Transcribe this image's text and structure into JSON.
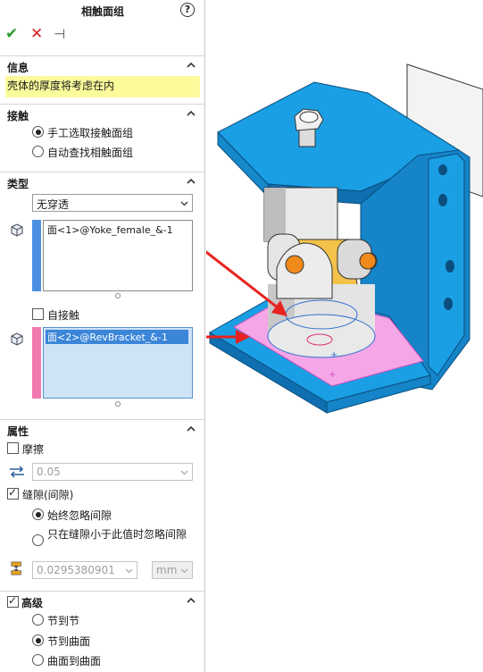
{
  "panel": {
    "title": "相触面组",
    "help_glyph": "?",
    "actions": {
      "ok": "✔",
      "cancel": "✕",
      "pin": "⊣"
    }
  },
  "info": {
    "header": "信息",
    "message": "壳体的厚度将考虑在内"
  },
  "contact": {
    "header": "接触",
    "options": [
      "手工选取接触面组",
      "自动查找相触面组"
    ],
    "selected": 0
  },
  "type": {
    "header": "类型",
    "value": "无穿透",
    "set1_item": "面<1>@Yoke_female_&-1",
    "self_contact_label": "自接触",
    "set2_item": "面<2>@RevBracket_&-1",
    "set1_color": "#4a90e2",
    "set2_color": "#f07ab0"
  },
  "properties": {
    "header": "属性",
    "friction_label": "摩擦",
    "friction_value": "0.05",
    "gap_label": "缝隙(间隙)",
    "gap_options": [
      "始终忽略间隙",
      "只在缝隙小于此值时忽略间隙"
    ],
    "gap_value": "0.0295380901",
    "gap_unit": "mm"
  },
  "advanced": {
    "header": "高级",
    "options": [
      "节到节",
      "节到曲面",
      "曲面到曲面"
    ],
    "selected": 1
  },
  "colors": {
    "ok": "#2e9b2e",
    "cancel": "#d62020",
    "highlight": "#fbfb9c",
    "model_blue": "#1a9fe5",
    "contact_pink": "#f5a6e6",
    "arrow": "#e8231f"
  }
}
